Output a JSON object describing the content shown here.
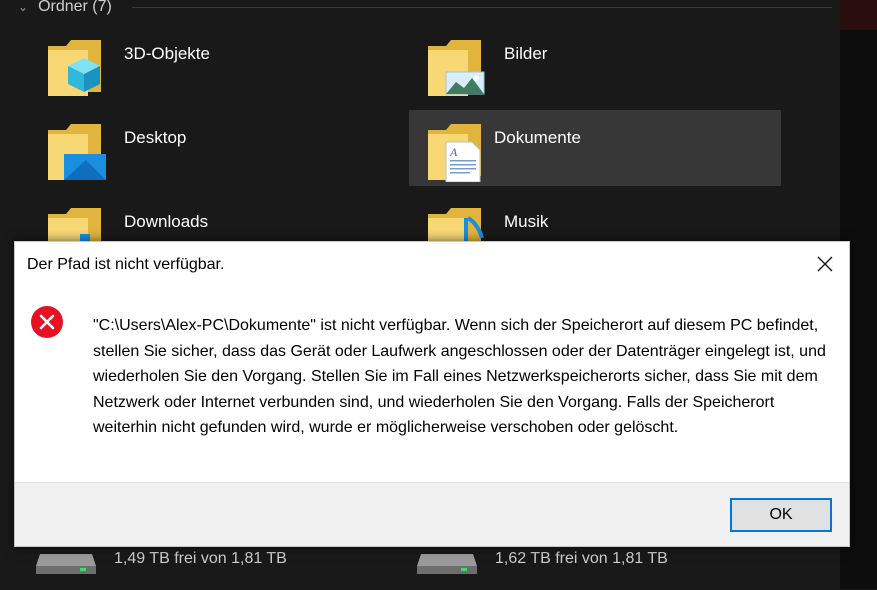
{
  "explorer": {
    "group_header": "Ordner (7)",
    "folders": [
      {
        "label": "3D-Objekte",
        "icon": "folder-3d-objects-icon"
      },
      {
        "label": "Bilder",
        "icon": "folder-pictures-icon"
      },
      {
        "label": "Desktop",
        "icon": "folder-desktop-icon"
      },
      {
        "label": "Dokumente",
        "icon": "folder-documents-icon",
        "selected": true
      },
      {
        "label": "Downloads",
        "icon": "folder-downloads-icon"
      },
      {
        "label": "Musik",
        "icon": "folder-music-icon"
      }
    ],
    "drives": [
      {
        "label": "1,49 TB frei von 1,81 TB",
        "icon": "hard-drive-icon"
      },
      {
        "label": "1,62 TB frei von 1,81 TB",
        "icon": "hard-drive-icon"
      }
    ]
  },
  "dialog": {
    "title": "Der Pfad ist nicht verfügbar.",
    "message": "\"C:\\Users\\Alex-PC\\Dokumente\" ist nicht verfügbar. Wenn sich der Speicherort auf diesem PC befindet, stellen Sie sicher, dass das Gerät oder Laufwerk angeschlossen oder der Datenträger eingelegt ist, und wiederholen Sie den Vorgang. Stellen Sie im Fall eines Netzwerkspeicherorts sicher, dass Sie mit dem Netzwerk oder Internet verbunden sind, und wiederholen Sie den Vorgang. Falls der Speicherort weiterhin nicht gefunden wird, wurde er möglicherweise verschoben oder gelöscht.",
    "ok_label": "OK",
    "icon": "error-icon"
  },
  "colors": {
    "folder_yellow": "#f8d775",
    "error_red": "#e81123",
    "accent_blue": "#0078d7"
  }
}
